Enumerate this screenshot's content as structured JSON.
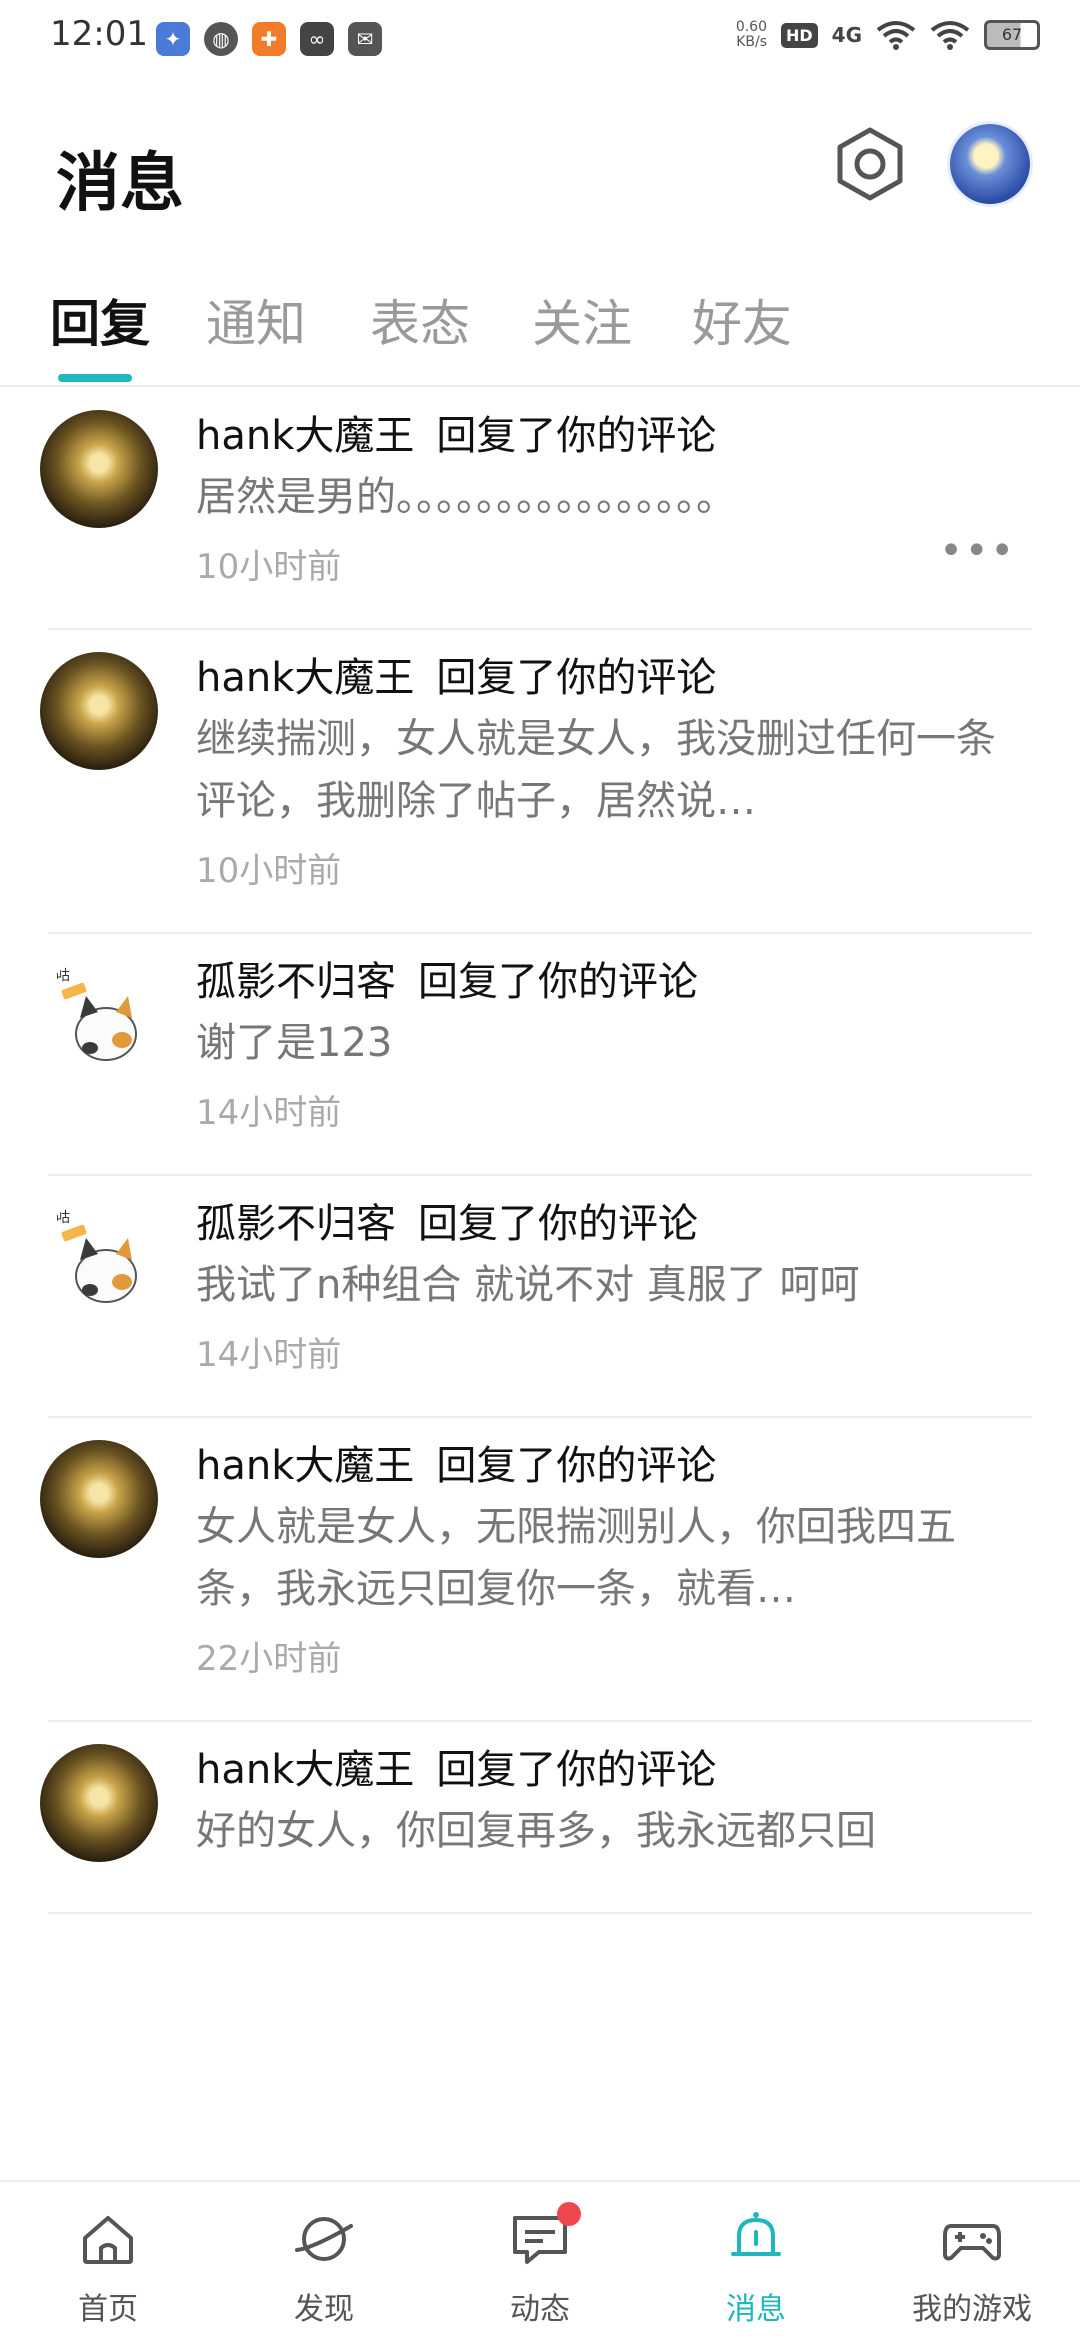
{
  "status_bar": {
    "time": "12:01",
    "net_speed_value": "0.60",
    "net_speed_unit": "KB/s",
    "hd": "HD",
    "signal": "4G",
    "battery": "67"
  },
  "header": {
    "title": "消息"
  },
  "tabs": [
    {
      "label": "回复",
      "active": true
    },
    {
      "label": "通知",
      "active": false
    },
    {
      "label": "表态",
      "active": false
    },
    {
      "label": "关注",
      "active": false
    },
    {
      "label": "好友",
      "active": false
    }
  ],
  "messages": [
    {
      "user": "hank大魔王",
      "action": "回复了你的评论",
      "text": "居然是男的。。。。。。。。。。。。。。。。",
      "time": "10小时前",
      "avatar": "hank"
    },
    {
      "user": "hank大魔王",
      "action": "回复了你的评论",
      "text": "继续揣测，女人就是女人，我没删过任何一条评论，我删除了帖子，居然说…",
      "time": "10小时前",
      "avatar": "hank"
    },
    {
      "user": "孤影不归客",
      "action": "回复了你的评论",
      "text": "谢了是123",
      "time": "14小时前",
      "avatar": "cat"
    },
    {
      "user": "孤影不归客",
      "action": "回复了你的评论",
      "text": "我试了n种组合  就说不对   真服了  呵呵",
      "time": "14小时前",
      "avatar": "cat"
    },
    {
      "user": "hank大魔王",
      "action": "回复了你的评论",
      "text": "女人就是女人，无限揣测别人，你回我四五条，我永远只回复你一条，就看…",
      "time": "22小时前",
      "avatar": "hank"
    },
    {
      "user": "hank大魔王",
      "action": "回复了你的评论",
      "text": "好的女人，你回复再多，我永远都只回",
      "time": "",
      "avatar": "hank"
    }
  ],
  "bottom_nav": [
    {
      "label": "首页",
      "icon": "home-icon"
    },
    {
      "label": "发现",
      "icon": "planet-icon"
    },
    {
      "label": "动态",
      "icon": "chat-icon",
      "badge": true
    },
    {
      "label": "消息",
      "icon": "bell-icon",
      "active": true
    },
    {
      "label": "我的游戏",
      "icon": "gamepad-icon"
    }
  ],
  "colors": {
    "accent": "#1fb6bf",
    "badge": "#f0474f"
  }
}
